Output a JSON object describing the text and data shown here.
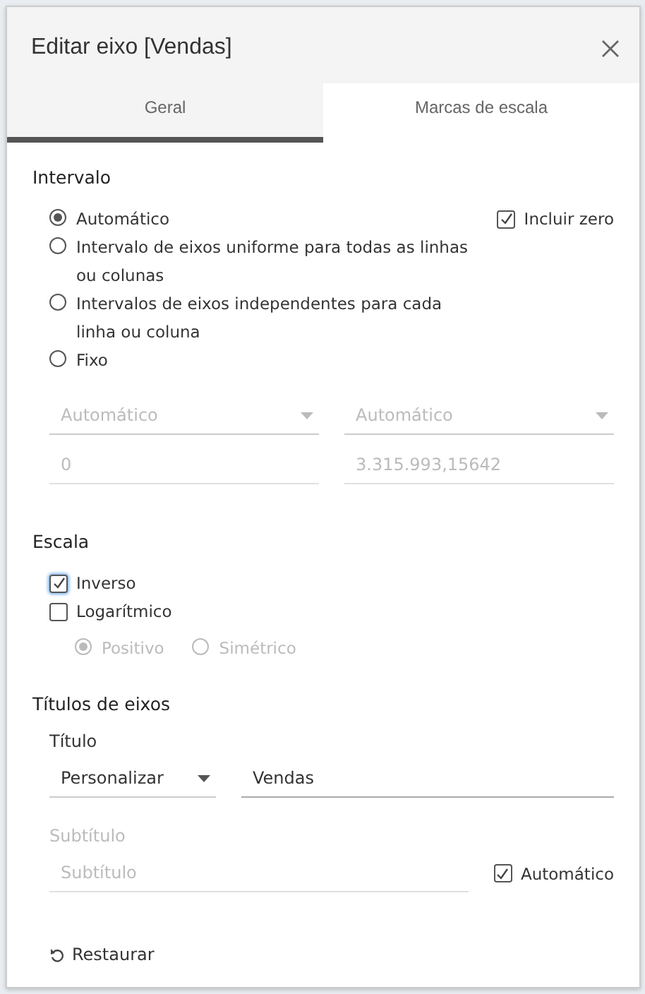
{
  "dialog": {
    "title": "Editar eixo [Vendas]"
  },
  "tabs": [
    {
      "label": "Geral",
      "selected": true
    },
    {
      "label": "Marcas de escala",
      "selected": false
    }
  ],
  "range": {
    "heading": "Intervalo",
    "options": [
      {
        "label": "Automático",
        "selected": true
      },
      {
        "label": "Intervalo de eixos uniforme para todas as linhas ou colunas",
        "selected": false
      },
      {
        "label": "Intervalos de eixos independentes para cada linha ou coluna",
        "selected": false
      },
      {
        "label": "Fixo",
        "selected": false
      }
    ],
    "include_zero": {
      "label": "Incluir zero",
      "checked": true
    },
    "start_select": {
      "value": "Automático",
      "disabled": true
    },
    "end_select": {
      "value": "Automático",
      "disabled": true
    },
    "start_value": {
      "value": "0",
      "disabled": true
    },
    "end_value": {
      "value": "3.315.993,15642",
      "disabled": true
    }
  },
  "scale": {
    "heading": "Escala",
    "reversed": {
      "label": "Inverso",
      "checked": true,
      "focused": true
    },
    "logarithmic": {
      "label": "Logarítmico",
      "checked": false
    },
    "log_options": [
      {
        "label": "Positivo",
        "selected": true,
        "disabled": true
      },
      {
        "label": "Simétrico",
        "selected": false,
        "disabled": true
      }
    ]
  },
  "axis_titles": {
    "heading": "Títulos de eixos",
    "title_label": "Título",
    "title_mode": {
      "value": "Personalizar",
      "disabled": false
    },
    "title_value": {
      "value": "Vendas",
      "disabled": false
    },
    "subtitle_label": {
      "text": "Subtítulo",
      "disabled": true
    },
    "subtitle_field": {
      "placeholder": "Subtítulo",
      "disabled": true
    },
    "subtitle_auto": {
      "label": "Automático",
      "checked": true
    }
  },
  "reset_button": {
    "label": "Restaurar"
  }
}
